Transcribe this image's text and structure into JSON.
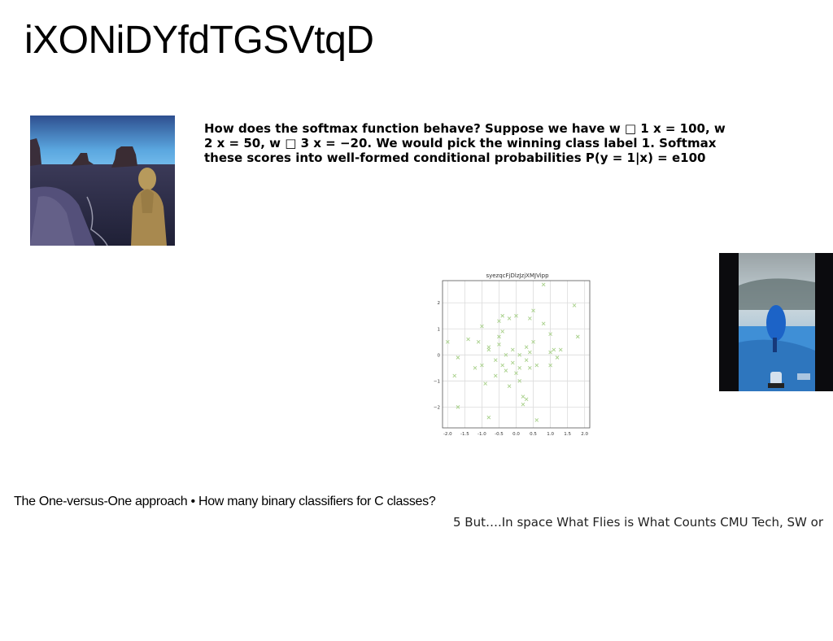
{
  "page": {
    "title": "iXONiDYfdTGSVtqD",
    "paragraph": {
      "lines": [
        "How does the softmax function behave? Suppose we have w □ 1 x = 100, w",
        "2 x = 50, w □ 3 x = −20. We would pick the winning class label 1. Softmax",
        "these scores into well-formed conditional probabilities P(y = 1|x) = e100"
      ]
    },
    "bottom_line_1": "The One-versus-One approach • How many binary classifiers for C classes?",
    "bottom_line_2": "5 But….In space What Flies is What Counts CMU Tech, SW or"
  },
  "chart_data": {
    "type": "scatter",
    "title": "syezqcFjDlzJzjXMJVipp",
    "xlabel": "",
    "ylabel": "",
    "xlim": [
      -2.15,
      2.15
    ],
    "ylim": [
      -2.8,
      2.85
    ],
    "xticks": [
      "-2.0",
      "-1.5",
      "-1.0",
      "-0.5",
      "0.0",
      "0.5",
      "1.0",
      "1.5",
      "2.0"
    ],
    "xtick_values": [
      -2.0,
      -1.5,
      -1.0,
      -0.5,
      0.0,
      0.5,
      1.0,
      1.5,
      2.0
    ],
    "yticks": [
      "2",
      "1",
      "0",
      "−1",
      "−2"
    ],
    "ytick_values": [
      2,
      1,
      0,
      -1,
      -2
    ],
    "grid": true,
    "marker": "x",
    "color": "#a8d08a",
    "series": [
      {
        "points": [
          [
            -2.0,
            0.5
          ],
          [
            -1.8,
            -0.8
          ],
          [
            -1.7,
            -0.1
          ],
          [
            -1.7,
            -2.0
          ],
          [
            -1.4,
            0.6
          ],
          [
            -1.1,
            0.5
          ],
          [
            -1.0,
            1.1
          ],
          [
            -1.0,
            -0.4
          ],
          [
            -0.9,
            -1.1
          ],
          [
            -0.8,
            0.3
          ],
          [
            -0.8,
            0.2
          ],
          [
            -0.8,
            -2.4
          ],
          [
            -0.6,
            -0.8
          ],
          [
            -0.5,
            1.3
          ],
          [
            -0.5,
            0.7
          ],
          [
            -0.5,
            0.4
          ],
          [
            -0.4,
            1.5
          ],
          [
            -0.4,
            0.9
          ],
          [
            -0.4,
            -0.4
          ],
          [
            -0.3,
            0.0
          ],
          [
            -0.3,
            -0.6
          ],
          [
            -0.2,
            1.4
          ],
          [
            -0.2,
            -1.2
          ],
          [
            -0.1,
            0.2
          ],
          [
            -0.1,
            -0.3
          ],
          [
            0.0,
            1.5
          ],
          [
            0.0,
            -0.7
          ],
          [
            0.1,
            -0.5
          ],
          [
            0.1,
            -1.0
          ],
          [
            0.2,
            -1.6
          ],
          [
            0.2,
            -1.9
          ],
          [
            0.3,
            0.3
          ],
          [
            0.3,
            -0.2
          ],
          [
            0.3,
            -1.7
          ],
          [
            0.4,
            0.1
          ],
          [
            0.4,
            -0.5
          ],
          [
            0.5,
            1.7
          ],
          [
            0.5,
            0.5
          ],
          [
            0.6,
            -0.4
          ],
          [
            0.6,
            -2.5
          ],
          [
            0.8,
            2.7
          ],
          [
            0.8,
            1.2
          ],
          [
            1.0,
            0.8
          ],
          [
            1.0,
            0.1
          ],
          [
            1.0,
            -0.4
          ],
          [
            1.1,
            0.2
          ],
          [
            1.2,
            -0.1
          ],
          [
            1.3,
            0.2
          ],
          [
            1.7,
            1.9
          ],
          [
            1.8,
            0.7
          ],
          [
            0.4,
            1.4
          ],
          [
            -0.6,
            -0.2
          ],
          [
            0.1,
            0.0
          ],
          [
            -1.2,
            -0.5
          ]
        ]
      }
    ]
  }
}
